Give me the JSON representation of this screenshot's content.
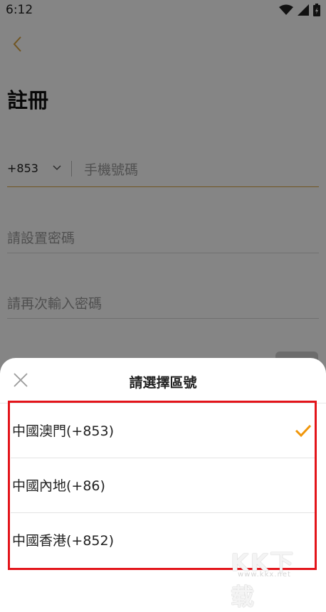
{
  "status_bar": {
    "time": "6:12"
  },
  "page": {
    "title": "註冊",
    "country_code": "+853",
    "phone_placeholder": "手機號碼",
    "password_placeholder": "請設置密碼",
    "confirm_password_placeholder": "請再次輸入密碼"
  },
  "sheet": {
    "title": "請選擇區號",
    "options": [
      {
        "label": "中國澳門(+853)",
        "selected": true
      },
      {
        "label": "中國內地(+86)",
        "selected": false
      },
      {
        "label": "中國香港(+852)",
        "selected": false
      }
    ]
  },
  "watermark": {
    "text": "KK下载",
    "sub": "www.kkx.net"
  },
  "colors": {
    "accent": "#f0960a",
    "highlight": "#e3141a",
    "underline_active": "#d9a441"
  }
}
